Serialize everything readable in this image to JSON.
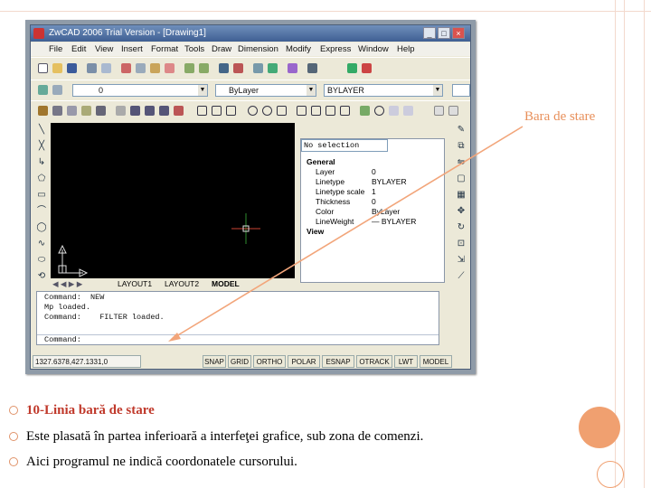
{
  "slide": {
    "annotation_label": "Bara de stare",
    "bullets": [
      "10-Linia bară de stare",
      "Este plasată în partea inferioară a interfeţei grafice, sub zona de comenzi.",
      "Aici programul ne indică coordonatele cursorului."
    ],
    "colors": {
      "bullet_title": "#c0392b",
      "accent": "#e8905b",
      "circle": "#f0a070",
      "arrow": "#f2a57a"
    }
  },
  "app": {
    "window_title": "ZwCAD 2006 Trial Version - [Drawing1]",
    "window_buttons": [
      "_",
      "□",
      "×"
    ],
    "menu": [
      "File",
      "Edit",
      "View",
      "Insert",
      "Format",
      "Tools",
      "Draw",
      "Dimension",
      "Modify",
      "Express",
      "Window",
      "Help"
    ],
    "layer_value": "0",
    "linetype_value": "ByLayer",
    "lineweight_value": "BYLAYER",
    "tabs": [
      "LAYOUT1",
      "LAYOUT2",
      "MODEL"
    ],
    "properties": {
      "selection": "No selection",
      "general_header": "General",
      "rows": [
        {
          "key": "Layer",
          "value": "0"
        },
        {
          "key": "Linetype",
          "value": "BYLAYER"
        },
        {
          "key": "Linetype scale",
          "value": "1"
        },
        {
          "key": "Thickness",
          "value": "0"
        },
        {
          "key": "Color",
          "value": "ByLayer"
        },
        {
          "key": "LineWeight",
          "value": "— BYLAYER"
        }
      ],
      "view_header": "View"
    },
    "command_history": [
      "Command:  NEW",
      "Mp loaded.",
      "Command:    FILTER loaded."
    ],
    "command_prompt": "Command:",
    "status": {
      "coordinates": "1327.6378,427.1331,0",
      "buttons": [
        "SNAP",
        "GRID",
        "ORTHO",
        "POLAR",
        "ESNAP",
        "OTRACK",
        "LWT",
        "MODEL"
      ]
    }
  }
}
